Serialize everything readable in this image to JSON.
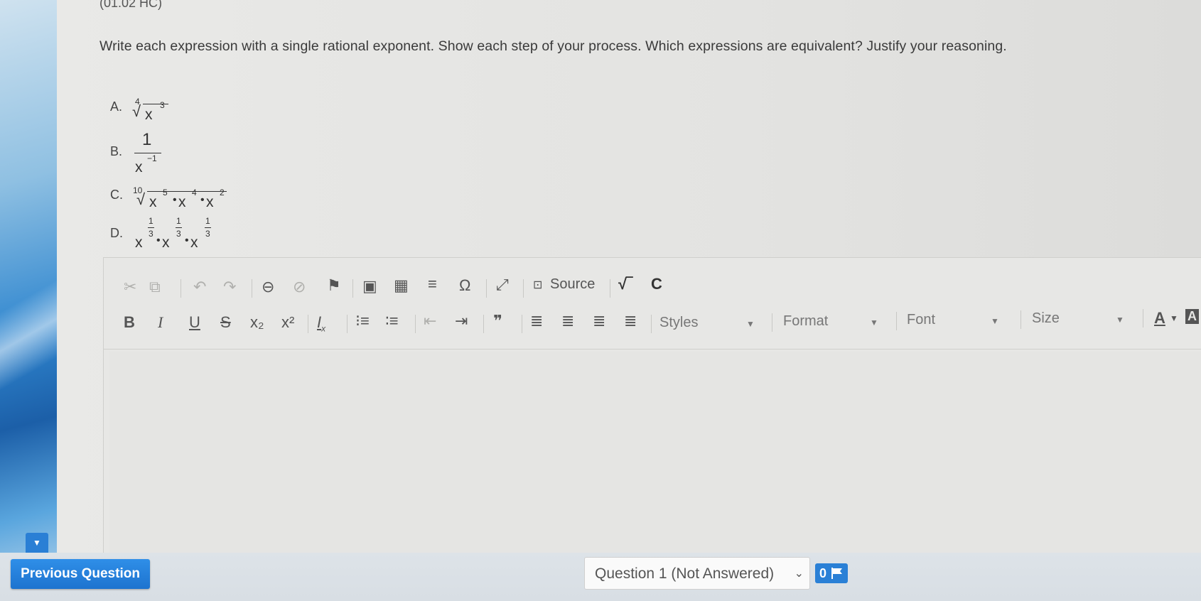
{
  "page": {
    "previous_id": "(01.02 HC)",
    "prompt": "Write each expression with a single rational exponent. Show each step of your process. Which expressions are equivalent? Justify your reasoning."
  },
  "options": [
    {
      "letter": "A.",
      "index": "4",
      "base": "x",
      "exp": "3"
    },
    {
      "letter": "B.",
      "numerator": "1",
      "base": "x",
      "exp": "−1"
    },
    {
      "letter": "C.",
      "index": "10",
      "terms": [
        {
          "base": "x",
          "exp": "5"
        },
        {
          "base": "x",
          "exp": "4"
        },
        {
          "base": "x",
          "exp": "2"
        }
      ],
      "dot": "•"
    },
    {
      "letter": "D.",
      "terms": [
        {
          "base": "x",
          "num": "1",
          "den": "3"
        },
        {
          "base": "x",
          "num": "1",
          "den": "3"
        },
        {
          "base": "x",
          "num": "1",
          "den": "3"
        }
      ],
      "dot": "•"
    }
  ],
  "toolbar": {
    "source_label": "Source",
    "styles_label": "Styles",
    "format_label": "Format",
    "font_label": "Font",
    "size_label": "Size",
    "bold": "B",
    "italic": "I",
    "underline": "U",
    "strike": "S",
    "subscript": "x₂",
    "superscript": "x²",
    "omega": "Ω",
    "quote": "❞",
    "text_color": "A"
  },
  "footer": {
    "prev_button": "Previous Question",
    "question_select": "Question 1 (Not Answered)",
    "flag_count": "0"
  }
}
